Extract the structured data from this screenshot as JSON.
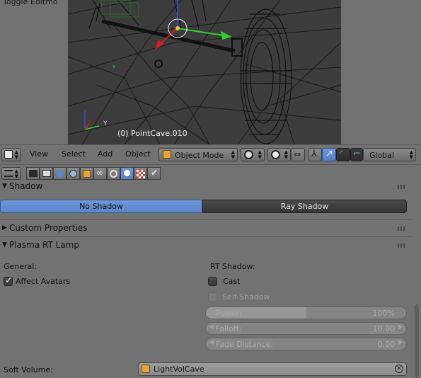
{
  "top_left_label": "Toggle Editmo",
  "viewport": {
    "object_name": "(0) PointCave.010",
    "axis_y": "Y"
  },
  "view_header": {
    "menus": [
      "View",
      "Select",
      "Add",
      "Object"
    ],
    "mode": "Object Mode",
    "orientation": "Global"
  },
  "panels": {
    "shadow": {
      "title": "Shadow",
      "options": [
        "No Shadow",
        "Ray Shadow"
      ],
      "selected": "No Shadow"
    },
    "custom_properties": {
      "title": "Custom Properties"
    },
    "plasma": {
      "title": "Plasma RT Lamp",
      "general_label": "General:",
      "affect_avatars": {
        "label": "Affect Avatars",
        "checked": true
      },
      "rt_shadow_label": "RT Shadow:",
      "cast": {
        "label": "Cast",
        "checked": false
      },
      "self_shadow": {
        "label": "Self-Shadow",
        "checked": false
      },
      "power": {
        "label": "Power:",
        "value": "100%",
        "fraction": 0.5
      },
      "falloff": {
        "label": "Falloff:",
        "value": "10.00"
      },
      "fade_distance": {
        "label": "Fade Distance:",
        "value": "0.00"
      },
      "soft_volume": {
        "label": "Soft Volume:",
        "value": "LightVolCave"
      }
    }
  },
  "colors": {
    "accent": "#5680c2",
    "panel_bg": "#727272",
    "viewport_bg": "#3c3c3c"
  }
}
